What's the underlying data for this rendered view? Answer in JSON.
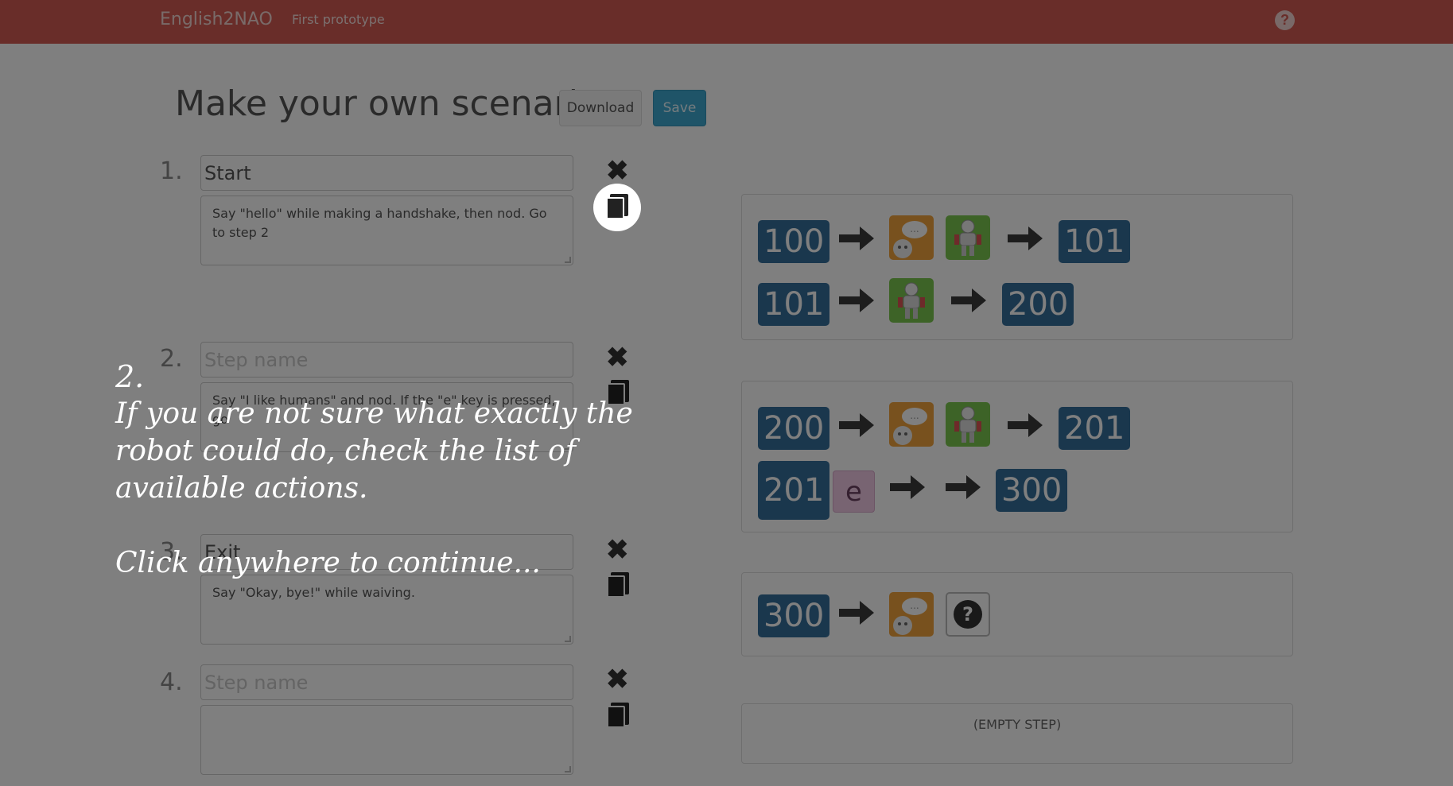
{
  "navbar": {
    "brand": "English2NAO",
    "link": "First prototype",
    "help_icon": "question-circle-icon"
  },
  "header": {
    "title": "Make your own scenario",
    "download_label": "Download",
    "save_label": "Save"
  },
  "steps": [
    {
      "number": "1.",
      "name_value": "Start",
      "name_placeholder": "Step name",
      "description": "Say \"hello\" while making a handshake, then nod. Go to step 2"
    },
    {
      "number": "2.",
      "name_value": "",
      "name_placeholder": "Step name",
      "description": "Say \"I like humans\" and nod. If the \"e\" key is pressed, go"
    },
    {
      "number": "3.",
      "name_value": "Exit",
      "name_placeholder": "Step name",
      "description": "Say \"Okay, bye!\" while waiving."
    },
    {
      "number": "4.",
      "name_value": "",
      "name_placeholder": "Step name",
      "description": ""
    }
  ],
  "action_panels": [
    {
      "rows": [
        {
          "from": "100",
          "to": "101"
        },
        {
          "from": "101",
          "to": "200"
        }
      ]
    },
    {
      "rows": [
        {
          "from": "200",
          "to": "201"
        },
        {
          "from": "201",
          "key": "e",
          "to": "300"
        }
      ]
    },
    {
      "rows": [
        {
          "from": "300"
        }
      ]
    },
    {
      "empty_label": "(EMPTY STEP)"
    }
  ],
  "tutorial": {
    "number": "2.",
    "text": "If you are not sure what exactly the robot could do, check the list of available actions.",
    "continue": "Click anywhere to continue..."
  },
  "colors": {
    "navbar": "#d25a52",
    "save_button": "#3fa9d1",
    "badge": "#346f9b",
    "speech_tile": "#f0a33c",
    "robot_tile": "#7ac74f",
    "key_tile": "#f0c8e4",
    "overlay": "rgba(0,0,0,0.5)"
  }
}
